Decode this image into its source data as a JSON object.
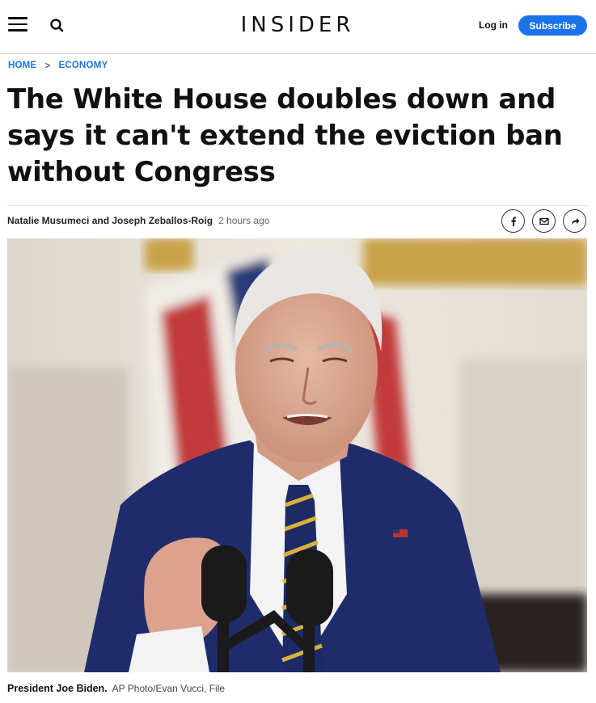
{
  "header": {
    "logo": "INSIDER",
    "login_label": "Log in",
    "subscribe_label": "Subscribe",
    "menu_icon": "hamburger-menu-icon",
    "search_icon": "search-icon"
  },
  "breadcrumb": {
    "home": "HOME",
    "section": "ECONOMY",
    "separator": ">"
  },
  "article": {
    "headline": "The White House doubles down and says it can't extend the eviction ban without Congress",
    "authors": "Natalie Musumeci and Joseph Zeballos-Roig",
    "time": "2 hours ago",
    "share_icons": [
      "facebook-icon",
      "email-icon",
      "share-icon"
    ]
  },
  "image": {
    "caption": "President Joe Biden.",
    "credit": "AP Photo/Evan Vucci, File"
  },
  "colors": {
    "accent": "#1a74e8",
    "text": "#111111"
  }
}
